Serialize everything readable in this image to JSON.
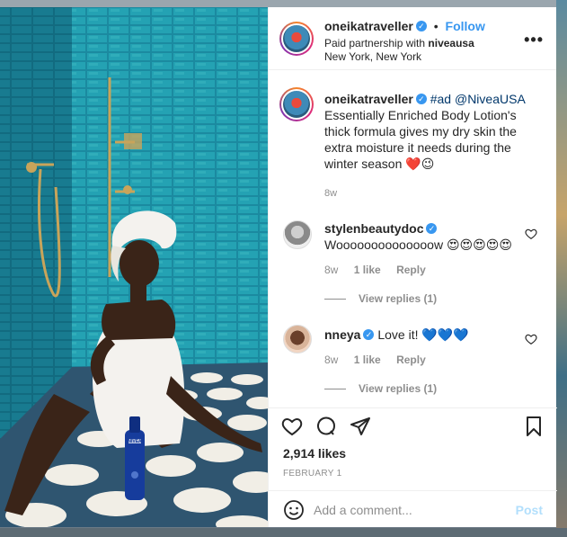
{
  "header": {
    "username": "oneikatraveller",
    "follow_label": "Follow",
    "partnership_prefix": "Paid partnership with ",
    "partner": "niveausa",
    "location": "New York, New York",
    "more_label": "•••"
  },
  "caption": {
    "username": "oneikatraveller",
    "hashtag": "#ad",
    "mention": "@NiveaUSA",
    "text": "Essentially Enriched Body Lotion's thick formula gives my dry skin the extra moisture it needs during the winter season ❤️😉",
    "time": "8w"
  },
  "comments": [
    {
      "username": "stylenbeautydoc",
      "text": "Woooooooooooooow 😍😍😍😍😍",
      "time": "8w",
      "likes": "1 like",
      "reply_label": "Reply",
      "view_replies": "View replies (1)"
    },
    {
      "username": "nneya",
      "text": "Love it! 💙💙💙",
      "time": "8w",
      "likes": "1 like",
      "reply_label": "Reply",
      "view_replies": "View replies (1)"
    }
  ],
  "post": {
    "likes": "2,914 likes",
    "date": "FEBRUARY 1",
    "product_label": "NIVEA"
  },
  "add_comment": {
    "placeholder": "Add a comment...",
    "post_label": "Post"
  },
  "colors": {
    "accent": "#3897f0",
    "tile": "#1f8fa3",
    "post_disabled": "#b2dffc"
  }
}
